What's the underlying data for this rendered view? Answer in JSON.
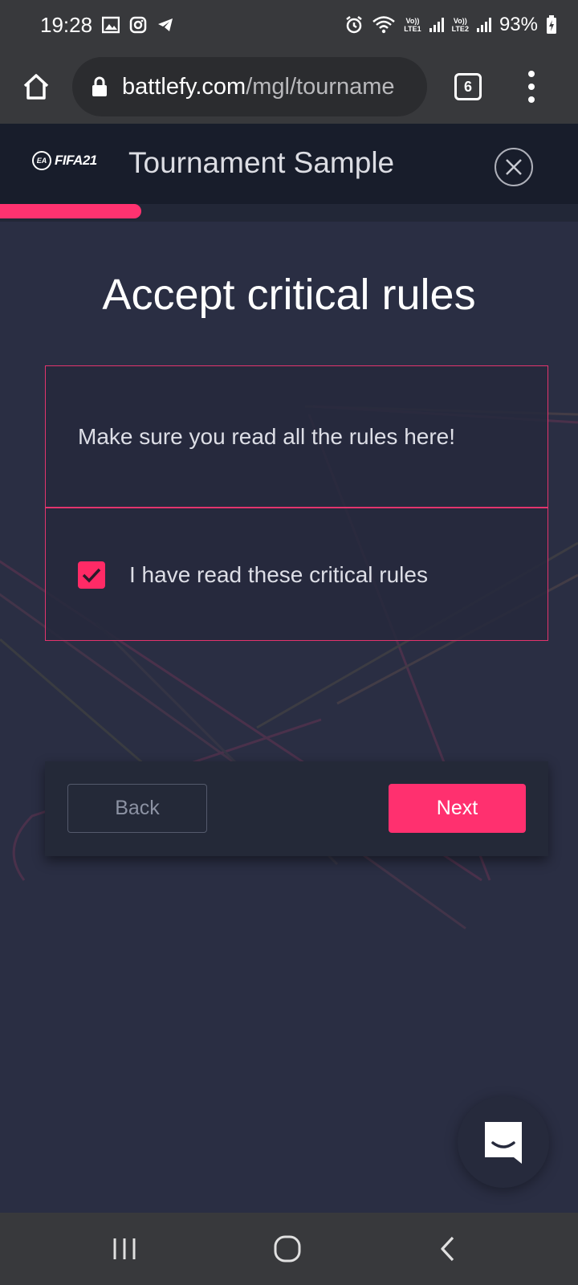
{
  "status_bar": {
    "time": "19:28",
    "sim1_label": "Vo))\nLTE1",
    "sim2_label": "Vo))\nLTE2",
    "battery": "93%",
    "icons": [
      "gallery-icon",
      "instagram-icon",
      "telegram-icon",
      "alarm-icon",
      "wifi-icon",
      "signal-icon",
      "battery-charging-icon"
    ]
  },
  "browser": {
    "url_domain": "battlefy.com",
    "url_path": "/mgl/tourname",
    "tab_count": "6"
  },
  "header": {
    "logo_ea": "EA",
    "logo_text": "FIFA21",
    "title": "Tournament Sample",
    "progress": 0.245
  },
  "main": {
    "title": "Accept critical rules",
    "rules_text": "Make sure you read all the rules here!",
    "checkbox_label": "I have read these critical rules",
    "checkbox_checked": true
  },
  "nav": {
    "back_label": "Back",
    "next_label": "Next"
  },
  "colors": {
    "accent": "#ff306f",
    "background": "#2a2e43",
    "header_bg": "#181d2b",
    "browser_chrome": "#38393c"
  }
}
